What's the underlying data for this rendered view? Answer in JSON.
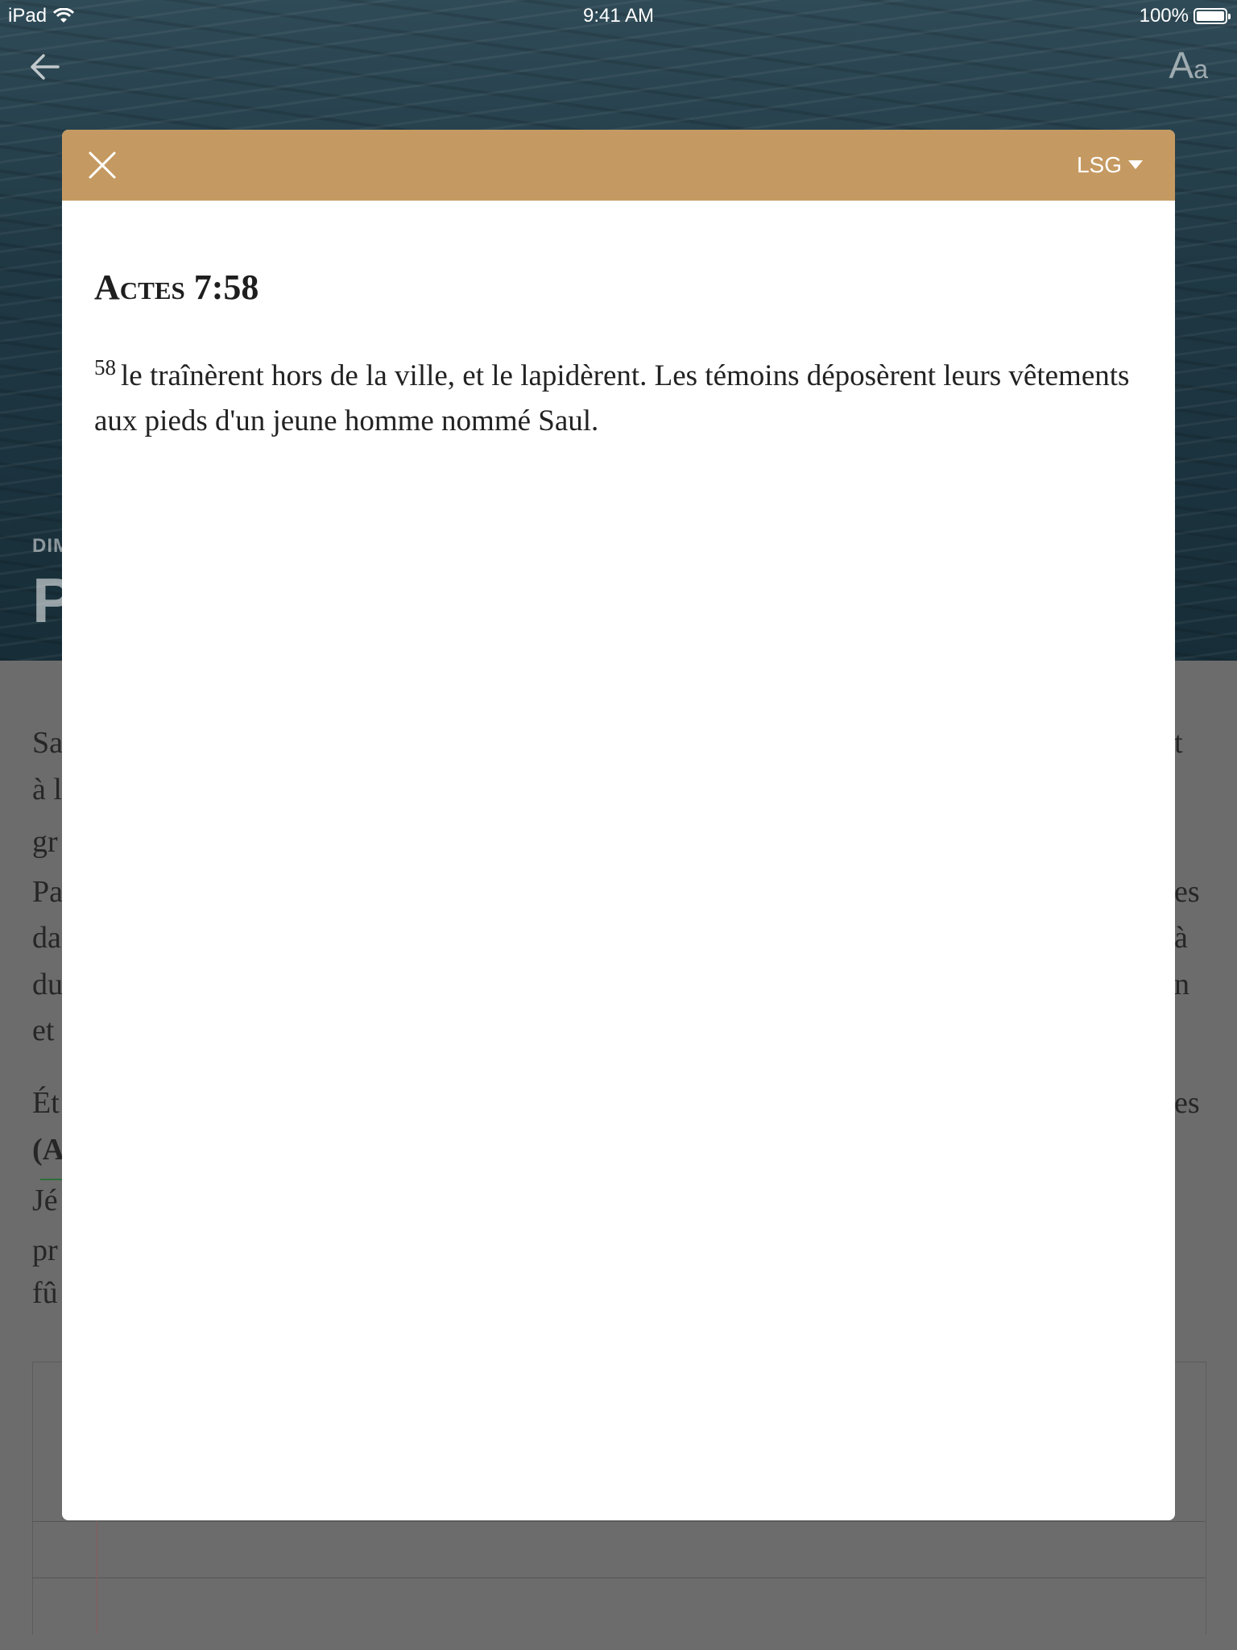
{
  "status_bar": {
    "device": "iPad",
    "time": "9:41 AM",
    "battery": "100%"
  },
  "header": {
    "back_icon": "arrow-left-icon",
    "font_size_icon_large": "A",
    "font_size_icon_small": "a"
  },
  "hero": {
    "subtitle_fragment": "DIM",
    "title_fragment": "P"
  },
  "article": {
    "left_fragments": [
      "Sa",
      "à l",
      "gr",
      "Pa",
      "da",
      "du",
      "et",
      "Ét",
      "(A",
      "Jé",
      "pr",
      "fû"
    ],
    "right_fragments": [
      "t",
      "es",
      "à",
      "n",
      "es"
    ]
  },
  "modal": {
    "close_icon": "close-icon",
    "version": "LSG",
    "reference": "Actes 7:58",
    "verse_number": "58",
    "verse_text": "le traînèrent hors de la ville, et le lapidèrent. Les témoins déposèrent leurs vêtements aux pieds d'un jeune homme nommé Saul."
  },
  "colors": {
    "modal_header": "#c59a62",
    "overlay": "#6a6a6a",
    "hero_water": "#1f3844"
  }
}
